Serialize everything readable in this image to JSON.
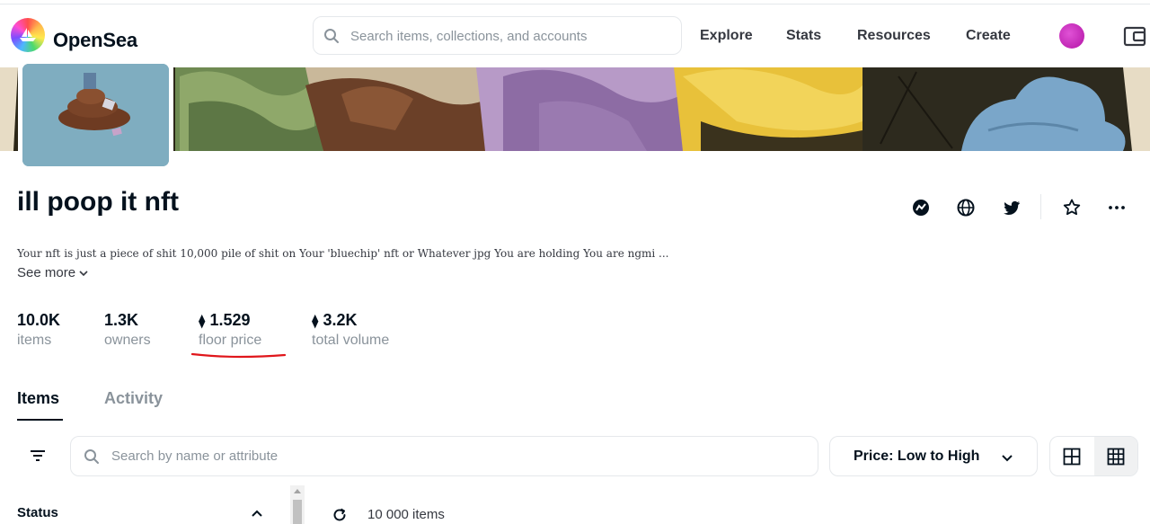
{
  "nav": {
    "brand": "OpenSea",
    "search_placeholder": "Search items, collections, and accounts",
    "links": [
      "Explore",
      "Stats",
      "Resources",
      "Create"
    ]
  },
  "collection": {
    "name": "ill poop it nft",
    "description": "Your nft is just a piece of shit 10,000 pile of shit on Your 'bluechip' nft or Whatever jpg You are holding You are ngmi ...",
    "see_more": "See more"
  },
  "stats": [
    {
      "value": "10.0K",
      "label": "items"
    },
    {
      "value": "1.3K",
      "label": "owners"
    },
    {
      "value": "1.529",
      "label": "floor price",
      "currency": "eth"
    },
    {
      "value": "3.2K",
      "label": "total volume",
      "currency": "eth"
    }
  ],
  "tabs": [
    {
      "label": "Items",
      "active": true
    },
    {
      "label": "Activity",
      "active": false
    }
  ],
  "toolbar": {
    "search_placeholder": "Search by name or attribute",
    "sort_label": "Price: Low to High"
  },
  "sidebar": {
    "status_label": "Status"
  },
  "results": {
    "count_label": "10 000 items"
  },
  "eth_symbol": "⧫",
  "colors": {
    "text": "#04111d",
    "muted": "#8a939b",
    "border": "#e5e8eb",
    "avatar": "#c21cb8",
    "annotation": "#e0161b"
  }
}
